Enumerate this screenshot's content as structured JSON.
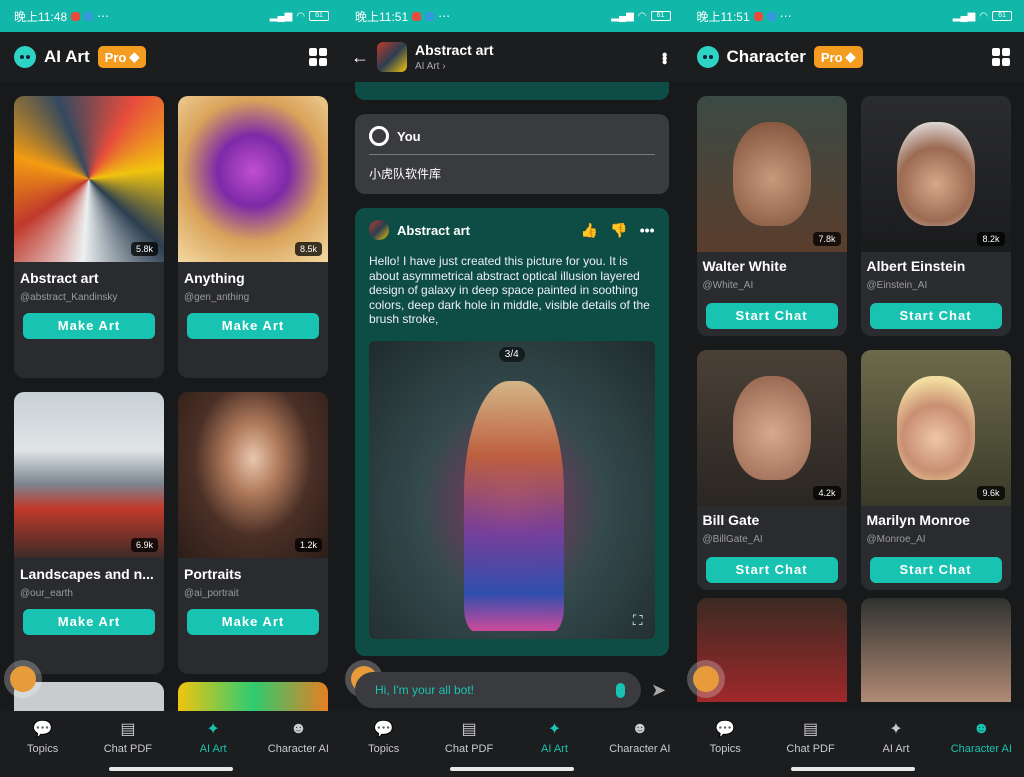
{
  "status_bars": [
    {
      "time": "晚上11:48",
      "right": "⋯"
    },
    {
      "time": "晚上11:51",
      "right": "⋯"
    },
    {
      "time": "晚上11:51",
      "right": "⋯"
    }
  ],
  "battery": "61",
  "screen1": {
    "title": "AI Art",
    "pro": "Pro",
    "cards": [
      {
        "name": "Abstract art",
        "handle": "@abstract_Kandinsky",
        "count": "5.8k",
        "button": "Make Art"
      },
      {
        "name": "Anything",
        "handle": "@gen_anthing",
        "count": "8.5k",
        "button": "Make Art"
      },
      {
        "name": "Landscapes and n...",
        "handle": "@our_earth",
        "count": "6.9k",
        "button": "Make Art"
      },
      {
        "name": "Portraits",
        "handle": "@ai_portrait",
        "count": "1.2k",
        "button": "Make Art"
      }
    ]
  },
  "screen2": {
    "title": "Abstract art",
    "subtitle": "AI Art",
    "user_name": "You",
    "user_message": "小虎队软件库",
    "bot_name": "Abstract art",
    "bot_message": "Hello! I have just created this picture for you. It is about asymmetrical abstract optical illusion layered design of galaxy in deep space painted in soothing colors, deep dark hole in middle, visible details of the brush stroke,",
    "image_pager": "3/4",
    "input_placeholder": "Hi, I'm your all bot!"
  },
  "screen3": {
    "title": "Character",
    "pro": "Pro",
    "cards": [
      {
        "name": "Walter White",
        "handle": "@White_AI",
        "count": "7.8k",
        "button": "Start Chat"
      },
      {
        "name": "Albert Einstein",
        "handle": "@Einstein_AI",
        "count": "8.2k",
        "button": "Start Chat"
      },
      {
        "name": "Bill Gate",
        "handle": "@BillGate_AI",
        "count": "4.2k",
        "button": "Start Chat"
      },
      {
        "name": "Marilyn Monroe",
        "handle": "@Monroe_AI",
        "count": "9.6k",
        "button": "Start Chat"
      }
    ]
  },
  "nav": [
    "Topics",
    "Chat PDF",
    "AI Art",
    "Character AI"
  ],
  "icons": {
    "pro": "diamond-icon",
    "grid": "grid-icon",
    "back": "arrow-left-icon",
    "more": "more-vertical-icon",
    "like": "thumb-up-icon",
    "dislike": "thumb-down-icon",
    "send": "send-icon",
    "mic": "mic-icon"
  },
  "colors": {
    "accent": "#19c3b1",
    "status_bar": "#11b8a9",
    "pro": "#f39c1f",
    "bot_bubble": "#0e4d45"
  }
}
